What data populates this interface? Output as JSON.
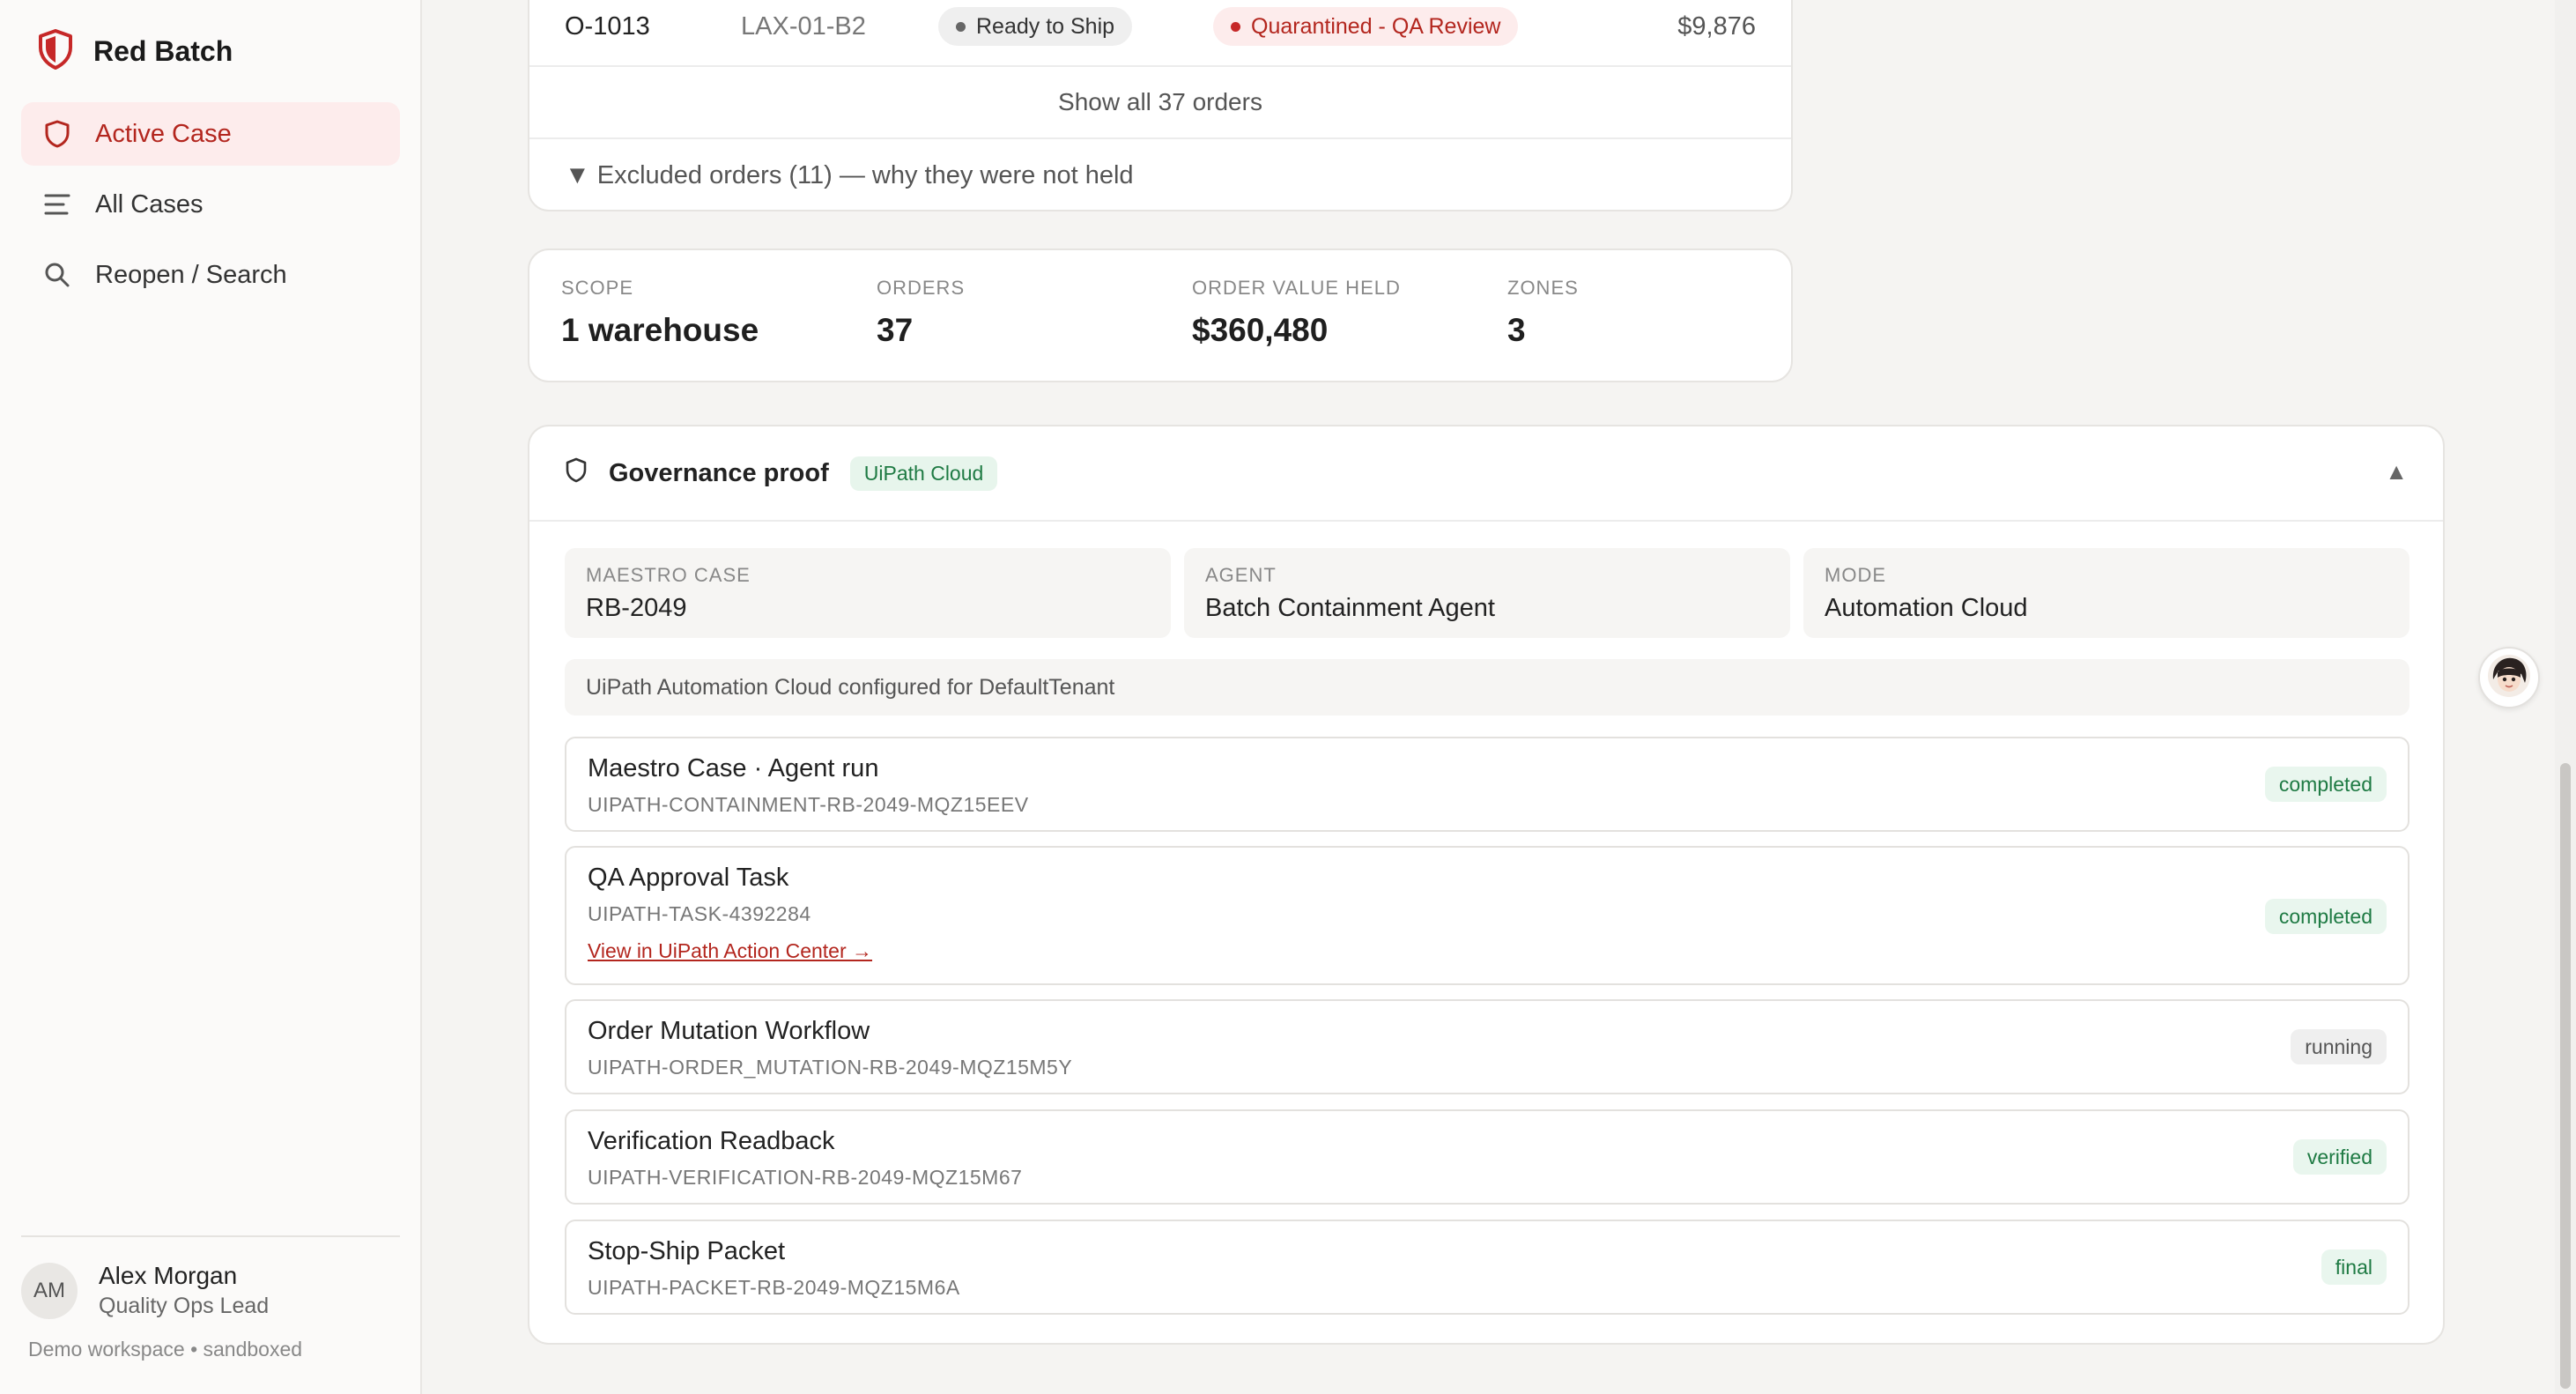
{
  "app": {
    "name": "Red Batch"
  },
  "sidebar": {
    "items": [
      {
        "label": "Active Case",
        "icon": "shield-icon"
      },
      {
        "label": "All Cases",
        "icon": "list-icon"
      },
      {
        "label": "Reopen / Search",
        "icon": "search-icon"
      }
    ],
    "user": {
      "initials": "AM",
      "name": "Alex Morgan",
      "role": "Quality Ops Lead"
    },
    "workspace": "Demo workspace • sandboxed"
  },
  "orders": {
    "row": {
      "id": "O-1013",
      "location": "LAX-01-B2",
      "status": "Ready to Ship",
      "hold": "Quarantined - QA Review",
      "amount": "$9,876"
    },
    "show_all": "Show all 37 orders",
    "excluded": "▼ Excluded orders (11) — why they were not held"
  },
  "stats": [
    {
      "label": "SCOPE",
      "value": "1 warehouse"
    },
    {
      "label": "ORDERS",
      "value": "37"
    },
    {
      "label": "ORDER VALUE HELD",
      "value": "$360,480"
    },
    {
      "label": "ZONES",
      "value": "3"
    }
  ],
  "governance": {
    "title": "Governance proof",
    "badge": "UiPath Cloud",
    "collapse": "▲",
    "meta": [
      {
        "label": "MAESTRO CASE",
        "value": "RB-2049"
      },
      {
        "label": "AGENT",
        "value": "Batch Containment Agent"
      },
      {
        "label": "MODE",
        "value": "Automation Cloud"
      }
    ],
    "config": "UiPath Automation Cloud configured for DefaultTenant",
    "runs": [
      {
        "title": "Maestro Case · Agent run",
        "id": "UIPATH-CONTAINMENT-RB-2049-MQZ15EEV",
        "status": "completed"
      },
      {
        "title": "QA Approval Task",
        "id": "UIPATH-TASK-4392284",
        "link": "View in UiPath Action Center →",
        "status": "completed"
      },
      {
        "title": "Order Mutation Workflow",
        "id": "UIPATH-ORDER_MUTATION-RB-2049-MQZ15M5Y",
        "status": "running"
      },
      {
        "title": "Verification Readback",
        "id": "UIPATH-VERIFICATION-RB-2049-MQZ15M67",
        "status": "verified"
      },
      {
        "title": "Stop-Ship Packet",
        "id": "UIPATH-PACKET-RB-2049-MQZ15M6A",
        "status": "final"
      }
    ]
  },
  "colors": {
    "accent": "#b3261e",
    "success": "#1e7a43"
  }
}
